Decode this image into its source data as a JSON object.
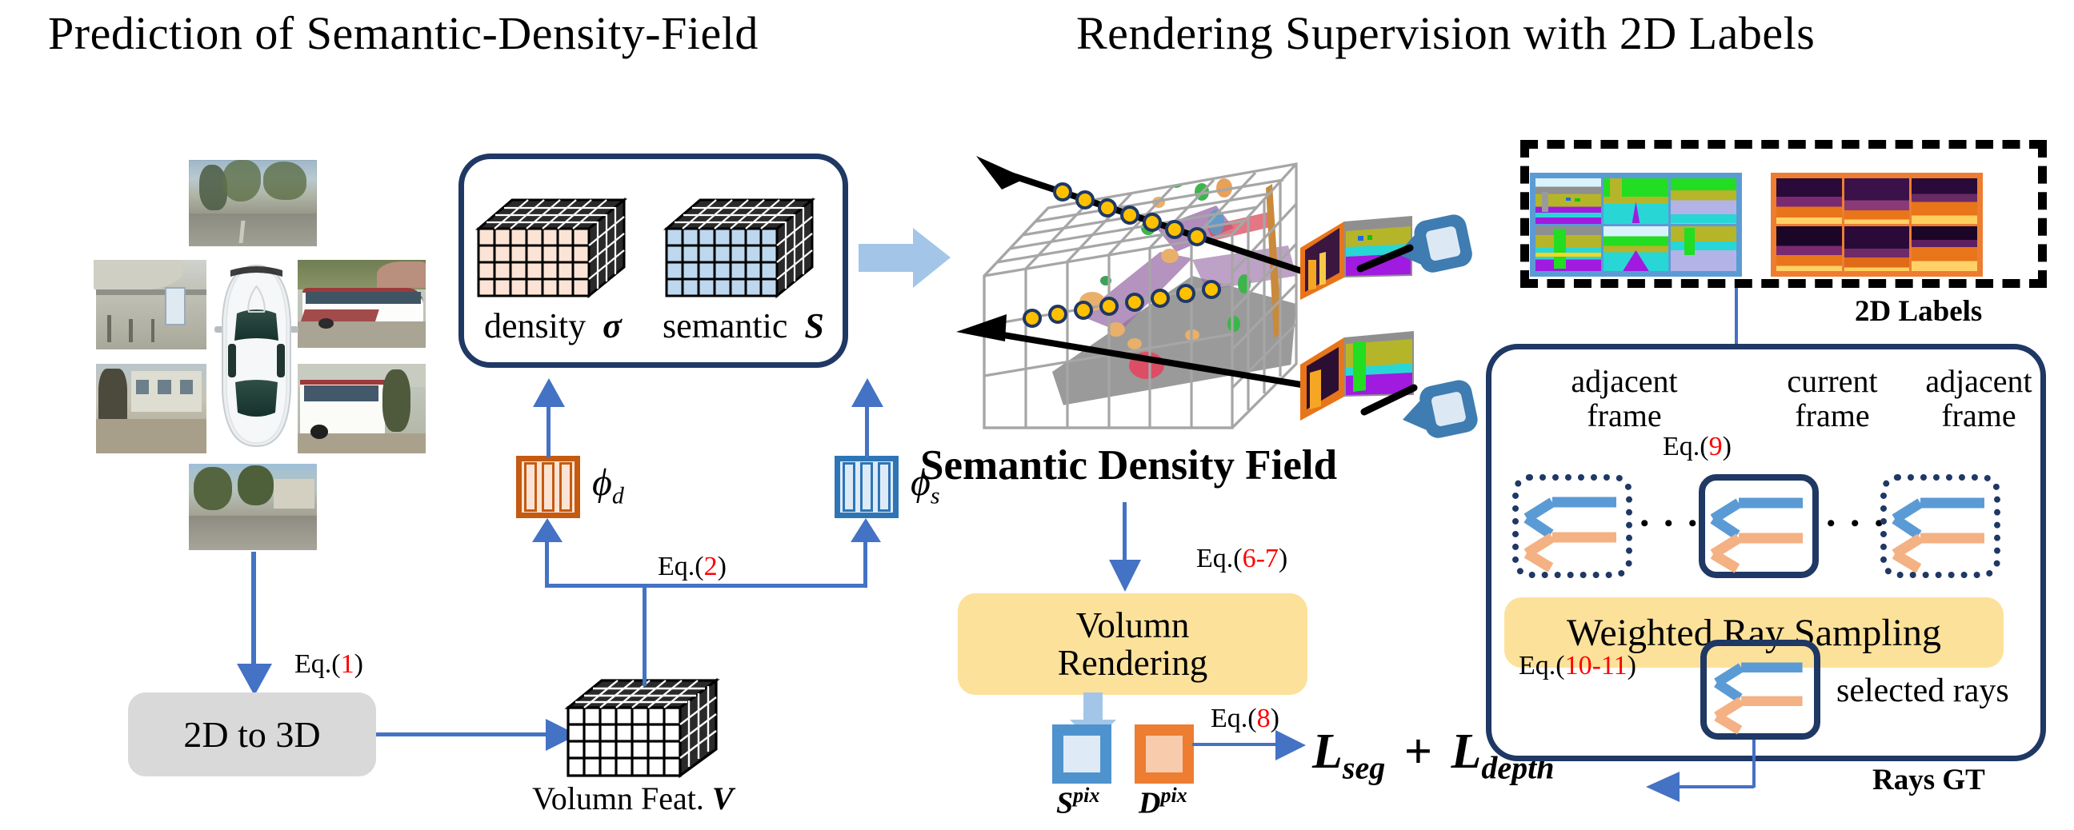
{
  "titles": {
    "left": "Prediction of  Semantic-Density-Field",
    "right": "Rendering Supervision with 2D Labels"
  },
  "left_panel": {
    "cubes": [
      {
        "name": "density-cube",
        "label_text": "density",
        "symbol": "σ",
        "color": "#fbe4d5"
      },
      {
        "name": "semantic-cube",
        "label_text": "semantic",
        "symbol": "S",
        "color": "#bdd7ee"
      }
    ],
    "mlps": [
      {
        "name": "phi-d",
        "symbol": "ϕ",
        "sub": "d",
        "color": "#c55a11",
        "fill": "#fbe4d5"
      },
      {
        "name": "phi-s",
        "symbol": "ϕ",
        "sub": "s",
        "color": "#2e75b6",
        "fill": "#deebf7"
      }
    ],
    "eq1": {
      "prefix": "Eq.(",
      "num": "1",
      "suffix": ")"
    },
    "eq2": {
      "prefix": "Eq.(",
      "num": "2",
      "suffix": ")"
    },
    "to3d_box_label": "2D to 3D",
    "volume_feat_label": "Volumn Feat.",
    "volume_feat_symbol": "V"
  },
  "center_panel": {
    "field_title": "Semantic Density Field",
    "eq67": {
      "prefix": "Eq.(",
      "num": "6-7",
      "suffix": ")"
    },
    "render_box": {
      "line1": "Volumn",
      "line2": "Rendering"
    },
    "eq8": {
      "prefix": "Eq.(",
      "num": "8",
      "suffix": ")"
    },
    "outputs": [
      {
        "name": "s-pix",
        "letter": "S",
        "sup": "pix",
        "border": "#4f93ce",
        "fill": "#deebf7"
      },
      {
        "name": "d-pix",
        "letter": "D",
        "sup": "pix",
        "border": "#ed7d31",
        "fill": "#f8cbad"
      }
    ],
    "loss_expression": "Lₛₑ𝓰 + L",
    "loss": {
      "l1": "L",
      "sub1": "seg",
      "plus": "+",
      "l2": "L",
      "sub2": "depth"
    }
  },
  "right_panel": {
    "labels_caption": "2D Labels",
    "rays_gt_caption": "Rays GT",
    "frames": [
      {
        "name": "adjacent-frame-left",
        "line1": "adjacent",
        "line2": "frame",
        "style": "dotted"
      },
      {
        "name": "current-frame",
        "line1": "current",
        "line2": "frame",
        "style": "solid"
      },
      {
        "name": "adjacent-frame-right",
        "line1": "adjacent",
        "line2": "frame",
        "style": "dotted"
      }
    ],
    "eq9": {
      "prefix": "Eq.(",
      "num": "9",
      "suffix": ")"
    },
    "eq1011": {
      "prefix": "Eq.(",
      "num": "10-11",
      "suffix": ")"
    },
    "sampling_box_label": "Weighted Ray Sampling",
    "selected_rays_label": "selected rays",
    "ellipsis": "• • •"
  },
  "colors": {
    "navy": "#1f3864",
    "blue_arrow": "#4472c4",
    "light_blue_arrow": "#a3c6e8",
    "yellow_box": "#fce19a",
    "gray_box": "#d9d9d9",
    "red": "#ff0000",
    "ray_blue": "#5b9bd5",
    "ray_orange": "#f4b183",
    "dot_yellow": "#ffc000"
  }
}
